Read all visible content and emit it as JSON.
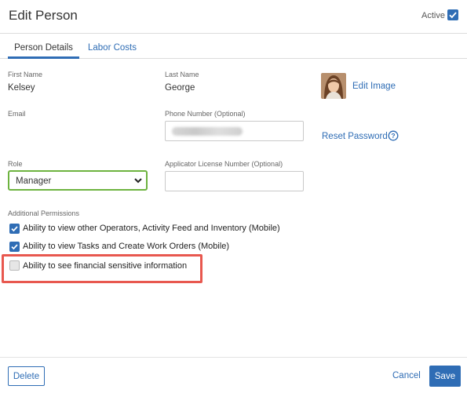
{
  "header": {
    "title": "Edit Person",
    "active_label": "Active",
    "active_checked": true
  },
  "tabs": [
    {
      "label": "Person Details",
      "active": true
    },
    {
      "label": "Labor Costs",
      "active": false
    }
  ],
  "person": {
    "first_name_label": "First Name",
    "first_name": "Kelsey",
    "last_name_label": "Last Name",
    "last_name": "George",
    "edit_image_label": "Edit Image",
    "email_label": "Email",
    "phone_label": "Phone Number (Optional)",
    "reset_password_label": "Reset Password",
    "role_label": "Role",
    "role_value": "Manager",
    "license_label": "Applicator License Number (Optional)",
    "license_value": ""
  },
  "permissions": {
    "label": "Additional Permissions",
    "items": [
      {
        "label": "Ability to view other Operators, Activity Feed and Inventory (Mobile)",
        "checked": true
      },
      {
        "label": "Ability to view Tasks and Create Work Orders (Mobile)",
        "checked": true
      },
      {
        "label": "Ability to see financial sensitive information",
        "checked": false
      }
    ]
  },
  "footer": {
    "delete_label": "Delete",
    "cancel_label": "Cancel",
    "save_label": "Save"
  },
  "colors": {
    "accent": "#2f6db5",
    "role_border": "#6db33f",
    "highlight": "#e8584f"
  }
}
